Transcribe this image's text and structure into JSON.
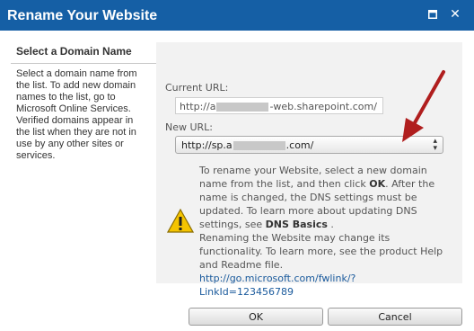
{
  "dialog": {
    "title": "Rename Your Website",
    "colors": {
      "titlebar": "#155fa5",
      "panel": "#f2f2f2",
      "link": "#1a5a9c",
      "annotation_arrow": "#b01e1e"
    }
  },
  "left_panel": {
    "heading": "Select a Domain Name",
    "description": "Select a domain name from the list. To add new domain names to the list, go to Microsoft Online Services. Verified domains appear in the list when they are not in use by any other sites or services."
  },
  "form": {
    "current_url_label": "Current URL:",
    "current_url_prefix": "http://a",
    "current_url_suffix": "-web.sharepoint.com/",
    "new_url_label": "New URL:",
    "new_url_prefix": "http://sp.a",
    "new_url_suffix": ".com/"
  },
  "message": {
    "line1_a": "To rename your Website, select a new domain name from the list, and then click ",
    "line1_ok": "OK",
    "line1_b": ". After the name is changed, the DNS settings must be updated. To learn more about updating DNS settings, see ",
    "dns_basics": "DNS Basics",
    "line1_c": " .",
    "warning": "Renaming the Website may change its functionality. To learn more, see the product Help and Readme file.",
    "link": "http://go.microsoft.com/fwlink/?LinkId=123456789"
  },
  "buttons": {
    "ok": "OK",
    "cancel": "Cancel"
  },
  "icons": {
    "maximize": "maximize-icon",
    "close": "close-icon",
    "warning": "warning-icon",
    "dropdown": "dropdown-arrow-icon"
  }
}
